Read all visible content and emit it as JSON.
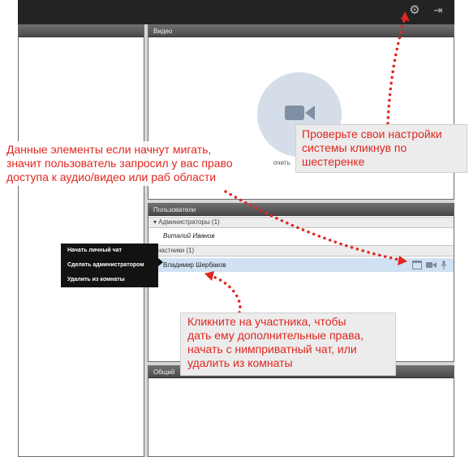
{
  "panels": {
    "video": {
      "title": "Видео",
      "hint": "очить"
    },
    "users": {
      "title": "Пользователи",
      "groups": [
        {
          "label": "▾ Администраторы (1)",
          "members": [
            "Виталий Иванов"
          ]
        },
        {
          "label": "Участники (1)",
          "members": [
            "Владимир Шербаков"
          ]
        }
      ]
    },
    "chat": {
      "title": "Общий"
    }
  },
  "context_menu": {
    "items": [
      "Начать личный чат",
      "Сделать администратором",
      "Удалить из комнаты"
    ]
  },
  "callouts": {
    "settings": [
      "Проверьте свои настройки",
      "системы кликнув по",
      "шестеренке"
    ],
    "permissions": [
      "Данные элементы если начнут мигать,",
      "значит пользователь запросил у вас право",
      "доступа к аудио/видео или раб области"
    ],
    "participant": [
      "Кликните на участника, чтобы",
      "дать ему дополнительные права,",
      " начать с нимприватный чат, или",
      "удалить из комнаты"
    ]
  },
  "icons": {
    "topbar": [
      "gear-icon",
      "exit-icon"
    ],
    "participant_row": [
      "screen-share-icon",
      "camera-icon",
      "microphone-icon"
    ]
  },
  "colors": {
    "accent_red": "#e0261f",
    "selected_row": "#cfe1f2",
    "topbar": "#232323"
  }
}
